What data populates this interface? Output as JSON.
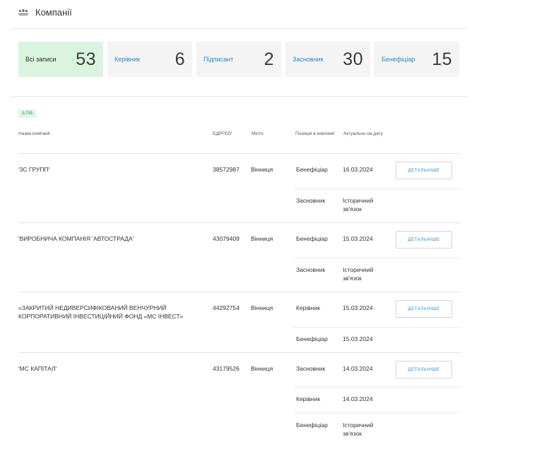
{
  "header": {
    "title": "Компанії"
  },
  "tiles": [
    {
      "label": "Всі записи",
      "count": "53"
    },
    {
      "label": "Керівник",
      "count": "6"
    },
    {
      "label": "Підписант",
      "count": "2"
    },
    {
      "label": "Засновник",
      "count": "30"
    },
    {
      "label": "Бенефіціар",
      "count": "15"
    }
  ],
  "filter_chip": {
    "label": "Δ ПІБ"
  },
  "table": {
    "headers": {
      "name": "Назва компанії",
      "code": "ЄДРПОУ",
      "city": "Місто",
      "position": "Позиція в компанії",
      "date": "Актуально на дату"
    },
    "button_label": "ДЕТАЛЬНІШЕ",
    "rows": [
      {
        "name": "'3С ГРУПП'",
        "code": "38572987",
        "city": "Вінниця",
        "roles": [
          {
            "position": "Бенефіціар",
            "date": "16.03.2024"
          },
          {
            "position": "Засновник",
            "date": "Історичний зв'язок"
          }
        ]
      },
      {
        "name": "'ВИРОБНИЧА КОМПАНІЯ 'АВТОСТРАДА'",
        "code": "43079409",
        "city": "Вінниця",
        "roles": [
          {
            "position": "Бенефіціар",
            "date": "15.03.2024"
          },
          {
            "position": "Засновник",
            "date": "Історичний зв'язок"
          }
        ]
      },
      {
        "name": "«ЗАКРИТИЙ НЕДИВЕРСИФІКОВАНИЙ ВЕНЧУРНИЙ КОРПОРАТИВНИЙ ІНВЕСТИЦІЙНИЙ ФОНД «МС ІНВЕСТ»",
        "code": "44292754",
        "city": "Вінниця",
        "roles": [
          {
            "position": "Керівник",
            "date": "15.03.2024"
          },
          {
            "position": "Бенефіціар",
            "date": "15.03.2024"
          }
        ]
      },
      {
        "name": "'МС КАПІТАЛ'",
        "code": "43179526",
        "city": "Вінниця",
        "roles": [
          {
            "position": "Засновник",
            "date": "14.03.2024"
          },
          {
            "position": "Керівник",
            "date": "14.03.2024"
          },
          {
            "position": "Бенефіціар",
            "date": "Історичний зв'язок"
          }
        ]
      }
    ]
  }
}
